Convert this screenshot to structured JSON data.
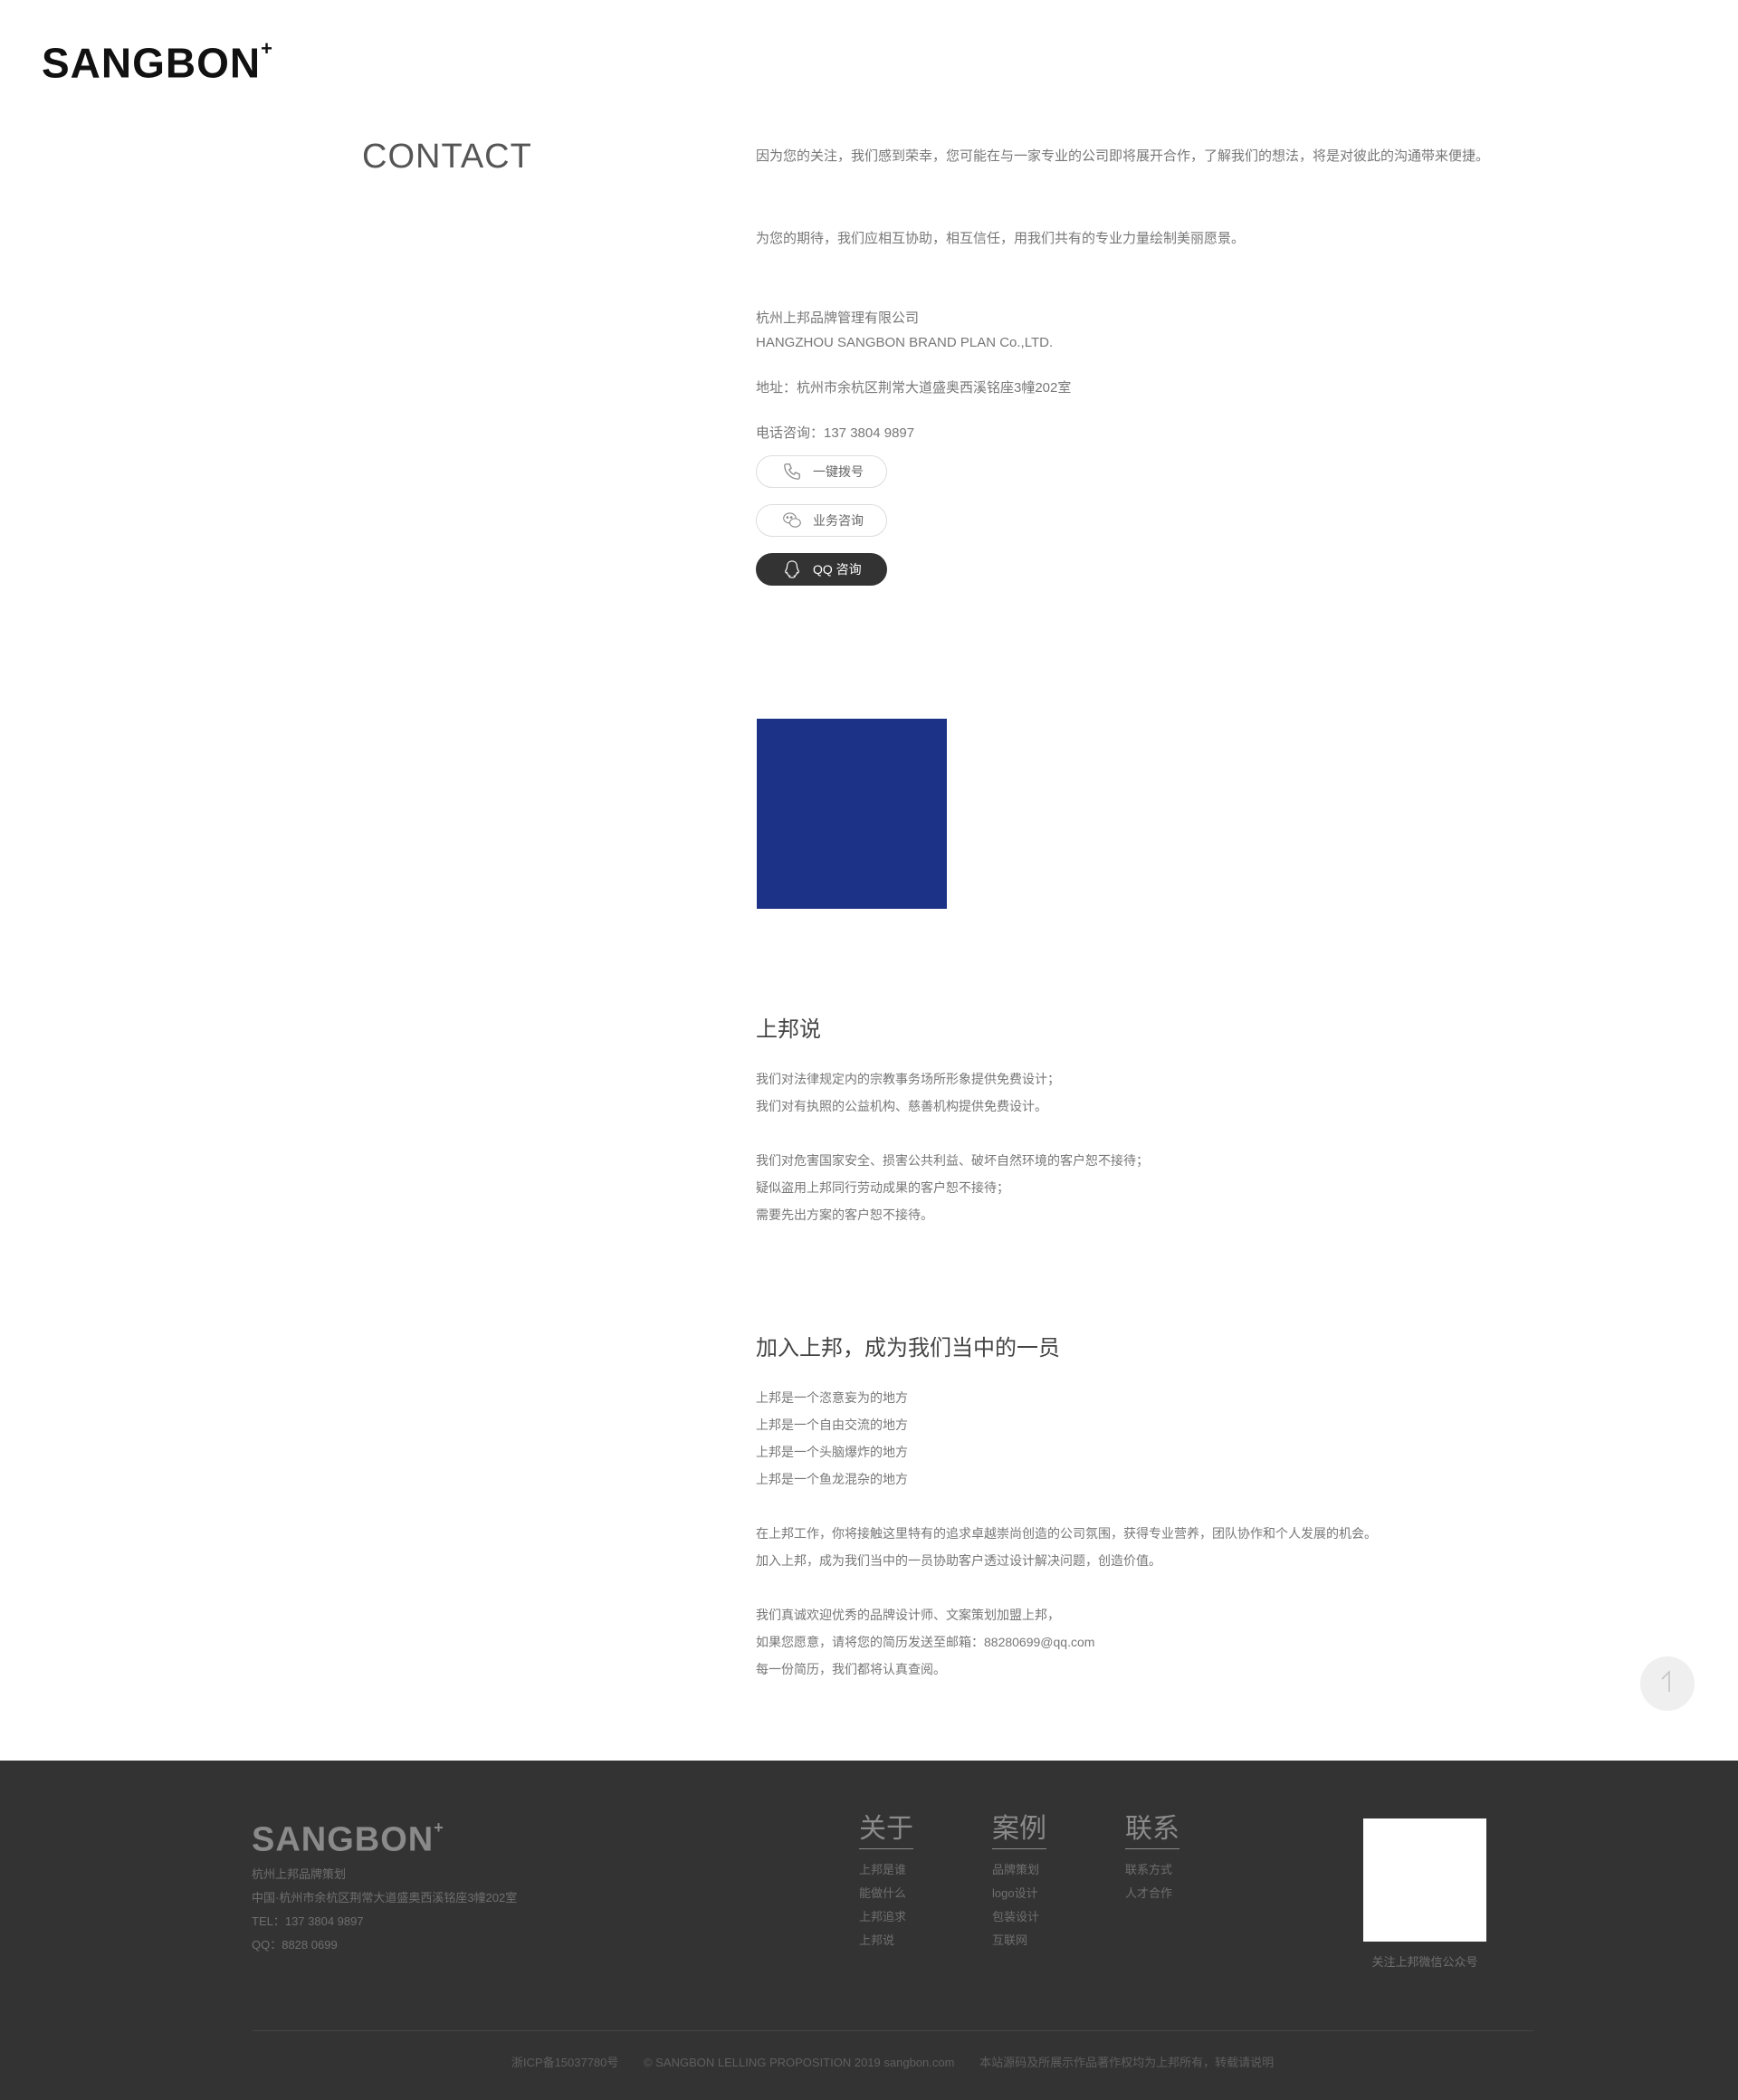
{
  "header": {
    "logo_text": "SANGBON",
    "logo_mark": "+"
  },
  "contact": {
    "heading": "CONTACT",
    "intro_1": "因为您的关注，我们感到荣幸，您可能在与一家专业的公司即将展开合作，了解我们的想法，将是对彼此的沟通带来便捷。",
    "intro_2": "为您的期待，我们应相互协助，相互信任，用我们共有的专业力量绘制美丽愿景。",
    "company_cn": "杭州上邦品牌管理有限公司",
    "company_en": "HANGZHOU SANGBON BRAND PLAN Co.,LTD.",
    "address": "地址：杭州市余杭区荆常大道盛奥西溪铭座3幢202室",
    "phone": "电话咨询：137 3804 9897",
    "buttons": {
      "call": "一键拨号",
      "wechat": "业务咨询",
      "qq": "QQ 咨询"
    },
    "brand_color": "#1c3286"
  },
  "shuo": {
    "title": "上邦说",
    "lines_a": [
      "我们对法律规定内的宗教事务场所形象提供免费设计；",
      "我们对有执照的公益机构、慈善机构提供免费设计。"
    ],
    "lines_b": [
      "我们对危害国家安全、损害公共利益、破坏自然环境的客户恕不接待；",
      "疑似盗用上邦同行劳动成果的客户恕不接待；",
      "需要先出方案的客户恕不接待。"
    ]
  },
  "join": {
    "title": "加入上邦，成为我们当中的一员",
    "lines_a": [
      "上邦是一个恣意妄为的地方",
      "上邦是一个自由交流的地方",
      "上邦是一个头脑爆炸的地方",
      "上邦是一个鱼龙混杂的地方"
    ],
    "lines_b": [
      "在上邦工作，你将接触这里特有的追求卓越崇尚创造的公司氛围，获得专业营养，团队协作和个人发展的机会。",
      "加入上邦，成为我们当中的一员协助客户透过设计解决问题，创造价值。"
    ],
    "lines_c": [
      "我们真诚欢迎优秀的品牌设计师、文案策划加盟上邦，",
      "如果您愿意，请将您的简历发送至邮箱：88280699@qq.com",
      "每一份简历，我们都将认真查阅。"
    ]
  },
  "footer": {
    "logo_text": "SANGBON",
    "logo_mark": "+",
    "info": [
      "杭州上邦品牌策划",
      "中国·杭州市余杭区荆常大道盛奥西溪铭座3幢202室",
      "TEL：137 3804 9897",
      "QQ：8828 0699"
    ],
    "columns": [
      {
        "heading": "关于",
        "links": [
          "上邦是谁",
          "能做什么",
          "上邦追求",
          "上邦说"
        ]
      },
      {
        "heading": "案例",
        "links": [
          "品牌策划",
          "logo设计",
          "包装设计",
          "互联网"
        ]
      },
      {
        "heading": "联系",
        "links": [
          "联系方式",
          "人才合作"
        ]
      }
    ],
    "qr_caption": "关注上邦微信公众号",
    "bottom": {
      "icp": "浙ICP备15037780号",
      "copyright": "© SANGBON LELLING PROPOSITION 2019 sangbon.com",
      "notice": "本站源码及所展示作品著作权均为上邦所有，转载请说明"
    }
  },
  "icons": {
    "call": "phone-icon",
    "wechat": "wechat-icon",
    "qq": "qq-icon",
    "scroll_top": "arrow-up-icon"
  }
}
